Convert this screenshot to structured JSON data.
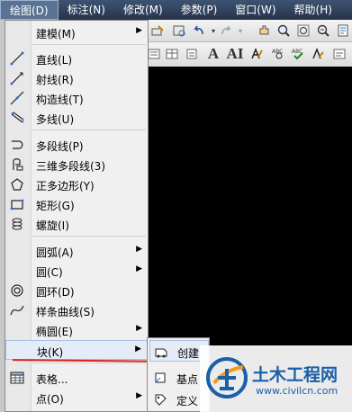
{
  "menubar": {
    "items": [
      {
        "label": "绘图(D)"
      },
      {
        "label": "标注(N)"
      },
      {
        "label": "修改(M)"
      },
      {
        "label": "参数(P)"
      },
      {
        "label": "窗口(W)"
      },
      {
        "label": "帮助(H)"
      }
    ]
  },
  "draw_menu": {
    "items": [
      {
        "label": "建模(M)"
      },
      {
        "label": "直线(L)"
      },
      {
        "label": "射线(R)"
      },
      {
        "label": "构造线(T)"
      },
      {
        "label": "多线(U)"
      },
      {
        "label": "多段线(P)"
      },
      {
        "label": "三维多段线(3)"
      },
      {
        "label": "正多边形(Y)"
      },
      {
        "label": "矩形(G)"
      },
      {
        "label": "螺旋(I)"
      },
      {
        "label": "圆弧(A)"
      },
      {
        "label": "圆(C)"
      },
      {
        "label": "圆环(D)"
      },
      {
        "label": "样条曲线(S)"
      },
      {
        "label": "椭圆(E)"
      },
      {
        "label": "块(K)"
      },
      {
        "label": "表格..."
      },
      {
        "label": "点(O)"
      }
    ]
  },
  "block_submenu": {
    "items": [
      {
        "label": "创建"
      },
      {
        "label": "基点"
      },
      {
        "label": "定义"
      }
    ]
  },
  "toolbar": {
    "text_a": "A",
    "text_ai": "AI"
  },
  "watermark": {
    "title": "土木工程网",
    "url": "www.civilcn.com"
  },
  "colors": {
    "menubar": "#2f3f58",
    "canvas": "#000000",
    "highlight": "#e3ecf7",
    "annotation": "#dd2222",
    "watermark": "#1a5fa8"
  }
}
